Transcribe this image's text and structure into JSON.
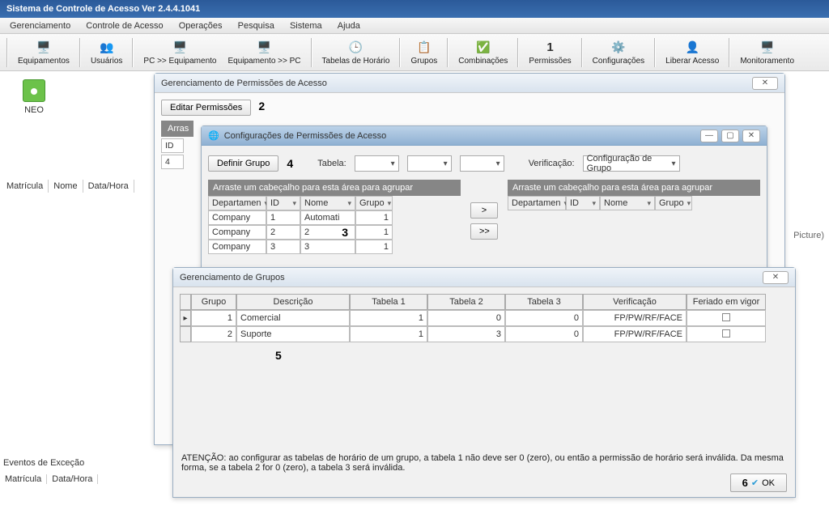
{
  "app": {
    "title": "Sistema de Controle de Acesso  Ver 2.4.4.1041"
  },
  "menu": {
    "items": [
      "Gerenciamento",
      "Controle de Acesso",
      "Operações",
      "Pesquisa",
      "Sistema",
      "Ajuda"
    ]
  },
  "toolbar": [
    {
      "icon": "🖥️",
      "label": "Equipamentos"
    },
    {
      "icon": "👥",
      "label": "Usuários"
    },
    {
      "icon": "🖥️",
      "label": "PC >> Equipamento"
    },
    {
      "icon": "🖥️",
      "label": "Equipamento >> PC"
    },
    {
      "icon": "🕒",
      "label": "Tabelas de Horário"
    },
    {
      "icon": "📋",
      "label": "Grupos"
    },
    {
      "icon": "✅",
      "label": "Combinações"
    },
    {
      "icon": "1",
      "label": "Permissões"
    },
    {
      "icon": "⚙️",
      "label": "Configurações"
    },
    {
      "icon": "👤",
      "label": "Liberar Acesso"
    },
    {
      "icon": "🖥️",
      "label": "Monitoramento"
    }
  ],
  "callouts": {
    "one": "1",
    "two": "2",
    "three": "3",
    "four": "4",
    "five": "5",
    "six": "6"
  },
  "desktop": {
    "neo": "NEO"
  },
  "mid_cols": [
    "Matrícula",
    "Nome",
    "Data/Hora"
  ],
  "btm_section": "Eventos de Exceção",
  "btm_cols": [
    "Matrícula",
    "Data/Hora"
  ],
  "right_cap": "Picture)",
  "win1": {
    "title": "Gerenciamento de Permissões de Acesso",
    "edit_btn": "Editar Permissões",
    "arra": "Arras",
    "id_hdr": "ID",
    "id_val": "4"
  },
  "win2": {
    "title": "Configurações de Permissões de Acesso",
    "definir": "Definir Grupo",
    "tabela_lbl": "Tabela:",
    "verif_lbl": "Verificação:",
    "verif_val": "Configuração de Grupo",
    "ghdr": "Arraste um cabeçalho para esta área para agrupar",
    "cols": [
      "Departamen",
      "ID",
      "Nome",
      "Grupo"
    ],
    "rows": [
      {
        "dep": "Company",
        "id": "1",
        "nome": "Automati",
        "grupo": "1"
      },
      {
        "dep": "Company",
        "id": "2",
        "nome": "2",
        "grupo": "1"
      },
      {
        "dep": "Company",
        "id": "3",
        "nome": "3",
        "grupo": "1"
      }
    ],
    "move1": ">",
    "move2": ">>"
  },
  "win3": {
    "title": "Gerenciamento de Grupos",
    "cols": [
      "Grupo",
      "Descrição",
      "Tabela 1",
      "Tabela 2",
      "Tabela 3",
      "Verificação",
      "Feriado em vigor"
    ],
    "rows": [
      {
        "grupo": "1",
        "desc": "Comercial",
        "t1": "1",
        "t2": "0",
        "t3": "0",
        "ver": "FP/PW/RF/FACE"
      },
      {
        "grupo": "2",
        "desc": "Suporte",
        "t1": "1",
        "t2": "3",
        "t3": "0",
        "ver": "FP/PW/RF/FACE"
      }
    ],
    "warn": "ATENÇÃO: ao configurar as tabelas de horário de um grupo, a tabela 1 não deve ser 0 (zero), ou então a permissão de horário será inválida. Da mesma forma, se a tabela 2 for 0 (zero), a tabela 3 será inválida.",
    "ok": "OK"
  },
  "sym": {
    "close": "✕",
    "min": "—",
    "max": "▢"
  }
}
